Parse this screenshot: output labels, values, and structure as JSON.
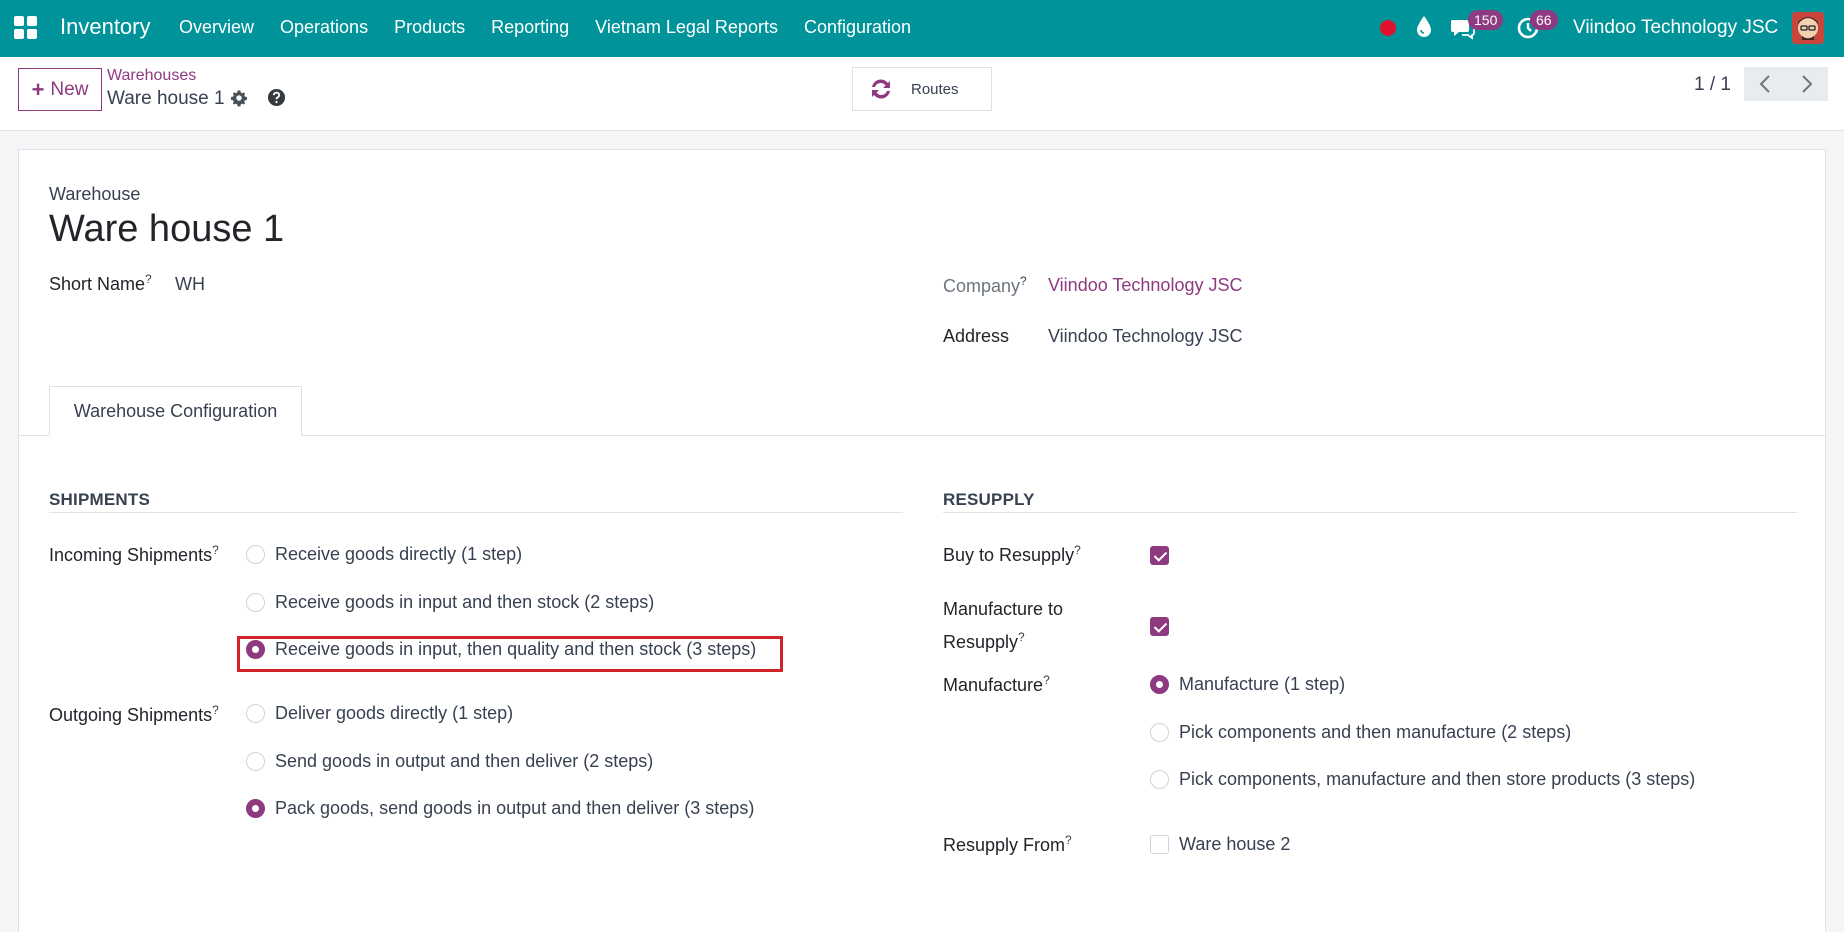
{
  "topnav": {
    "app_name": "Inventory",
    "menu": [
      "Overview",
      "Operations",
      "Products",
      "Reporting",
      "Vietnam Legal Reports",
      "Configuration"
    ],
    "chat_count": "150",
    "activity_count": "66",
    "company": "Viindoo Technology JSC",
    "color": "#00949a"
  },
  "control": {
    "new_label": "New",
    "breadcrumb_parent": "Warehouses",
    "breadcrumb_current": "Ware house 1",
    "routes_label": "Routes",
    "pager": "1 / 1"
  },
  "form": {
    "heading_label": "Warehouse",
    "name": "Ware house 1",
    "short_name_label": "Short Name",
    "short_name": "WH",
    "company_label": "Company",
    "company": "Viindoo Technology JSC",
    "address_label": "Address",
    "address": "Viindoo Technology JSC",
    "tab_label": "Warehouse Configuration",
    "help_mark": "?",
    "shipments": {
      "title": "SHIPMENTS",
      "incoming_label": "Incoming Shipments",
      "incoming_options": [
        "Receive goods directly (1 step)",
        "Receive goods in input and then stock (2 steps)",
        "Receive goods in input, then quality and then stock (3 steps)"
      ],
      "incoming_selected": 2,
      "outgoing_label": "Outgoing Shipments",
      "outgoing_options": [
        "Deliver goods directly (1 step)",
        "Send goods in output and then deliver (2 steps)",
        "Pack goods, send goods in output and then deliver (3 steps)"
      ],
      "outgoing_selected": 2
    },
    "resupply": {
      "title": "RESUPPLY",
      "buy_label": "Buy to Resupply",
      "buy_checked": true,
      "manufacture_to_resupply_label_1": "Manufacture to",
      "manufacture_to_resupply_label_2": "Resupply",
      "manufacture_to_resupply_checked": true,
      "manufacture_label": "Manufacture",
      "manufacture_options": [
        "Manufacture (1 step)",
        "Pick components and then manufacture (2 steps)",
        "Pick components, manufacture and then store products (3 steps)"
      ],
      "manufacture_selected": 0,
      "resupply_from_label": "Resupply From",
      "resupply_from_option": "Ware house 2",
      "resupply_from_checked": false
    }
  },
  "accent_color": "#8e3a80",
  "highlight_color": "#d2232a"
}
